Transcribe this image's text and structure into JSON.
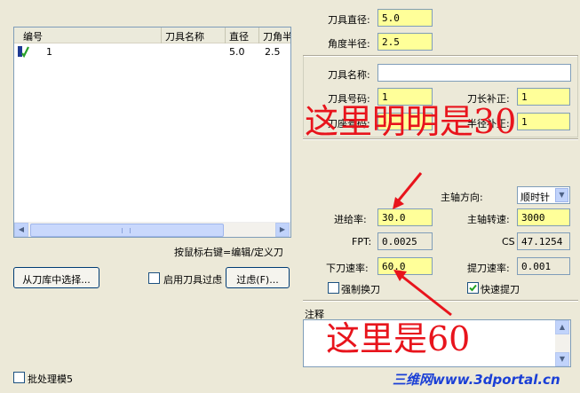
{
  "tool_list": {
    "columns": [
      "编号",
      "刀具名称",
      "直径",
      "刀角半"
    ],
    "rows": [
      {
        "number": "1",
        "name": "",
        "diameter": "5.0",
        "corner": "2.5"
      }
    ]
  },
  "hint_text": "按鼠标右键=编辑/定义刀",
  "buttons": {
    "from_library": "从刀库中选择...",
    "filter": "过虑(F)..."
  },
  "checkboxes": {
    "enable_filter": "启用刀具过虑",
    "batch": "批处理模5",
    "force_change": "强制换刀",
    "rapid_retract": "快速提刀"
  },
  "fields": {
    "tool_diameter": {
      "label": "刀具直径:",
      "value": "5.0"
    },
    "corner_radius": {
      "label": "角度半径:",
      "value": "2.5"
    },
    "tool_name": {
      "label": "刀具名称:",
      "value": ""
    },
    "tool_number": {
      "label": "刀具号码:",
      "value": "1"
    },
    "length_comp": {
      "label": "刀长补正:",
      "value": "1"
    },
    "holder_number": {
      "label": "刀座号码:",
      "value": "-1"
    },
    "radius_comp": {
      "label": "半径补正:",
      "value": "1"
    },
    "spindle_dir": {
      "label": "主轴方向:",
      "value": "顺时针"
    },
    "feed_rate": {
      "label": "进给率:",
      "value": "30.0"
    },
    "spindle_speed": {
      "label": "主轴转速:",
      "value": "3000"
    },
    "fpt": {
      "label": "FPT:",
      "value": "0.0025"
    },
    "cs": {
      "label": "CS",
      "value": "47.1254"
    },
    "plunge_rate": {
      "label": "下刀速率:",
      "value": "60.0"
    },
    "retract_rate": {
      "label": "提刀速率:",
      "value": "0.001"
    }
  },
  "notes_label": "注释",
  "annotations": {
    "note1": "这里明明是30",
    "note2": "这里是60"
  },
  "watermark": "三维网www.3dportal.cn",
  "colors": {
    "dialog_bg": "#ece9d8",
    "highlight_field": "#ffff99",
    "annotation_red": "#e8141c",
    "watermark_blue": "#1a3fd6"
  }
}
